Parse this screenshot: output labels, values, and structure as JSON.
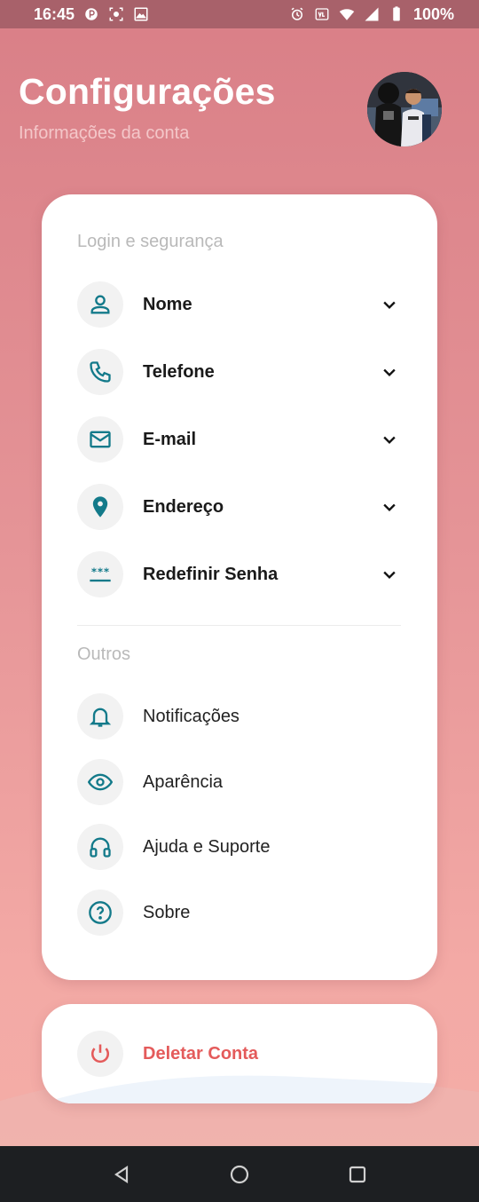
{
  "status": {
    "time": "16:45",
    "battery": "100%",
    "icons": [
      "data-saver-icon",
      "screenshot-icon",
      "image-icon",
      "alarm-icon",
      "volte-icon",
      "wifi-icon",
      "signal-icon",
      "battery-icon"
    ]
  },
  "header": {
    "title": "Configurações",
    "subtitle": "Informações da conta"
  },
  "sections": {
    "login_title": "Login e segurança",
    "others_title": "Outros"
  },
  "login_items": [
    {
      "label": "Nome",
      "icon": "person-icon"
    },
    {
      "label": "Telefone",
      "icon": "phone-icon"
    },
    {
      "label": "E-mail",
      "icon": "mail-icon"
    },
    {
      "label": "Endereço",
      "icon": "location-pin-icon"
    },
    {
      "label": "Redefinir Senha",
      "icon": "password-icon"
    }
  ],
  "other_items": [
    {
      "label": "Notificações",
      "icon": "bell-icon"
    },
    {
      "label": "Aparência",
      "icon": "eye-icon"
    },
    {
      "label": "Ajuda e Suporte",
      "icon": "headset-icon"
    },
    {
      "label": "Sobre",
      "icon": "help-circle-icon"
    }
  ],
  "danger": {
    "label": "Deletar Conta",
    "icon": "power-icon"
  },
  "colors": {
    "accent": "#137a8a",
    "danger": "#e45b5b",
    "background_top": "#d97f87",
    "background_bottom": "#f4aea7"
  }
}
